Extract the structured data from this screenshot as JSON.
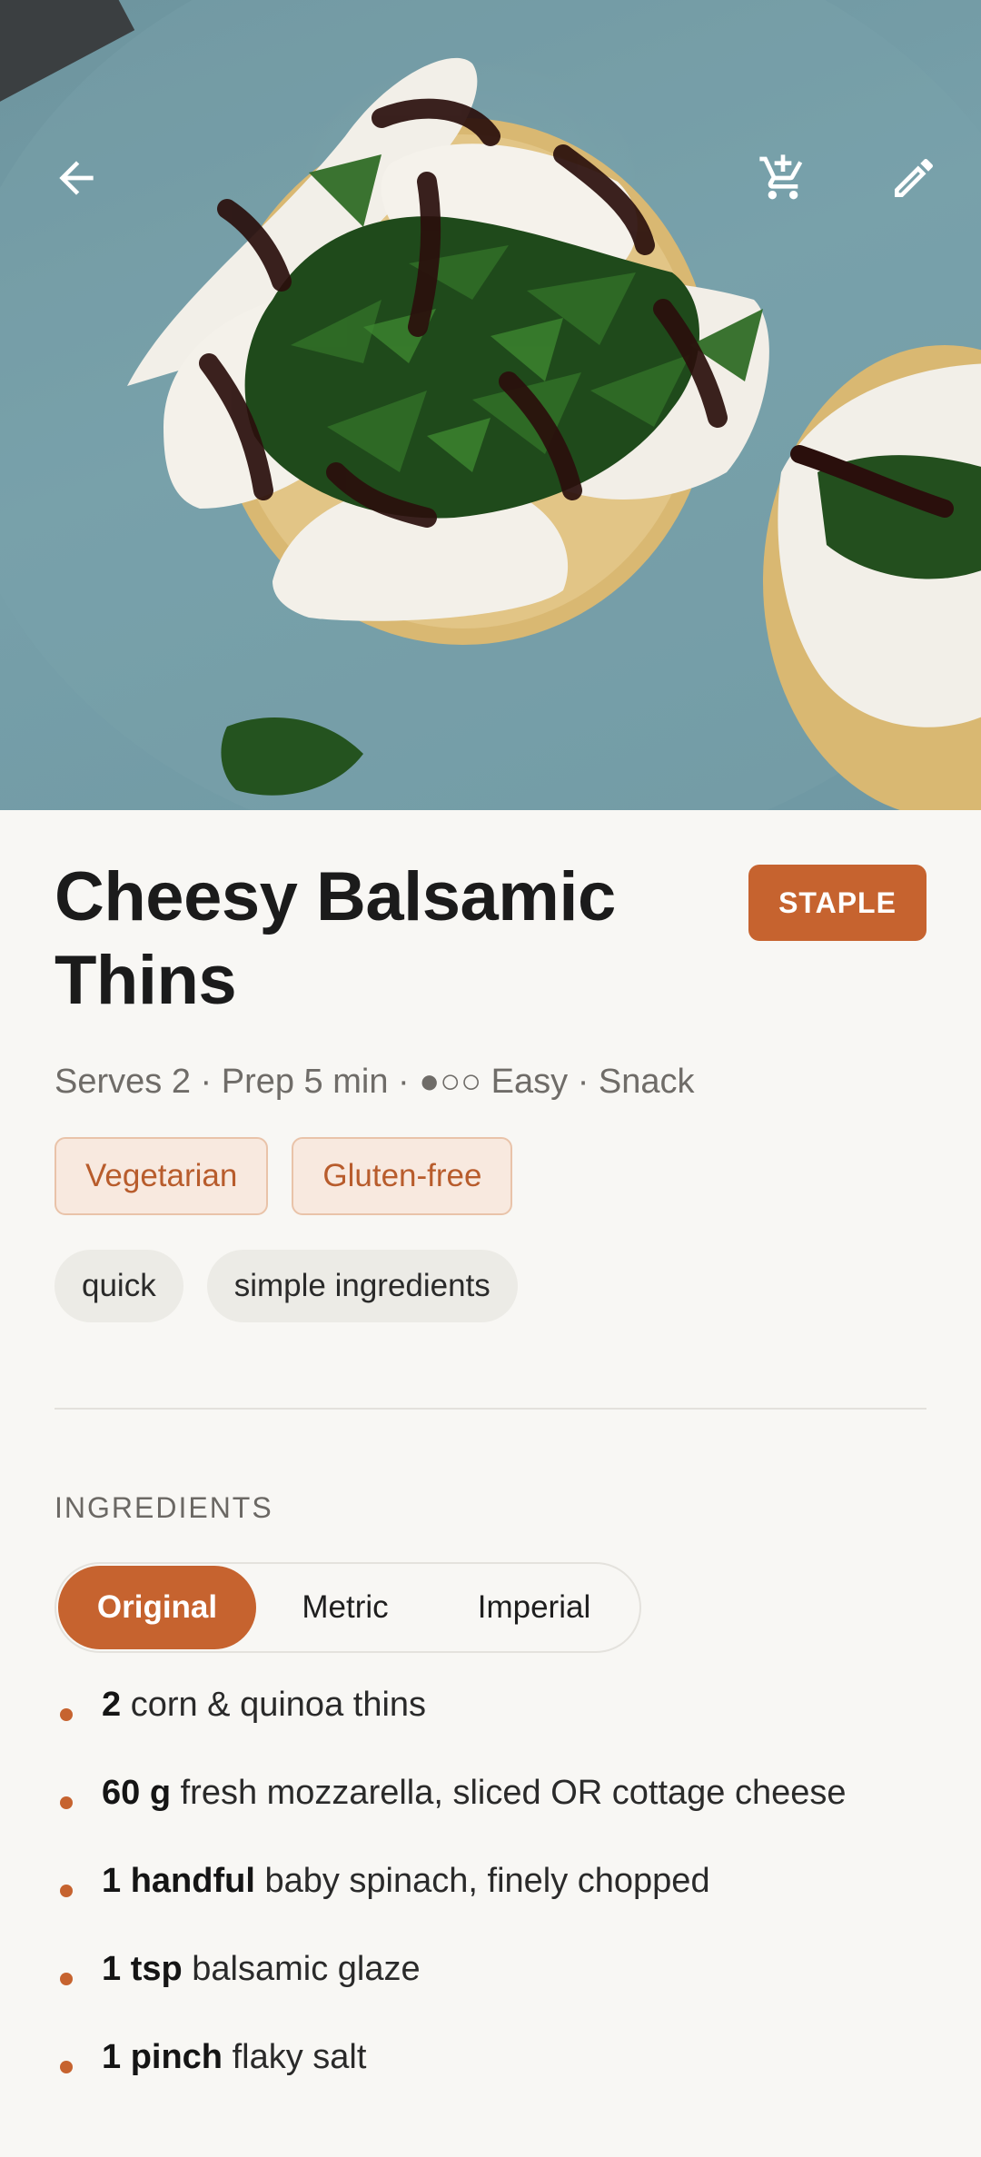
{
  "header": {
    "back_icon": "arrow-left-icon",
    "cart_icon": "cart-add-icon",
    "edit_icon": "pencil-icon"
  },
  "recipe": {
    "title": "Cheesy Balsamic Thins",
    "badge": "STAPLE",
    "meta": "Serves 2 · Prep 5 min · ●○○ Easy · Snack",
    "diet_tags": [
      "Vegetarian",
      "Gluten-free"
    ],
    "tags": [
      "quick",
      "simple ingredients"
    ]
  },
  "ingredients": {
    "section_title": "INGREDIENTS",
    "units": {
      "options": [
        "Original",
        "Metric",
        "Imperial"
      ],
      "selected": "Original"
    },
    "items": [
      {
        "qty": "2",
        "text": "corn & quinoa thins"
      },
      {
        "qty": "60 g",
        "text": "fresh mozzarella, sliced OR cottage cheese"
      },
      {
        "qty": "1 handful",
        "text": "baby spinach, finely chopped"
      },
      {
        "qty": "1 tsp",
        "text": "balsamic glaze"
      },
      {
        "qty": "1 pinch",
        "text": "flaky salt"
      }
    ]
  },
  "colors": {
    "accent": "#c6632f",
    "background": "#f8f7f4",
    "diet_tag_bg": "#f8e9df",
    "tag_bg": "#ecebe6"
  }
}
